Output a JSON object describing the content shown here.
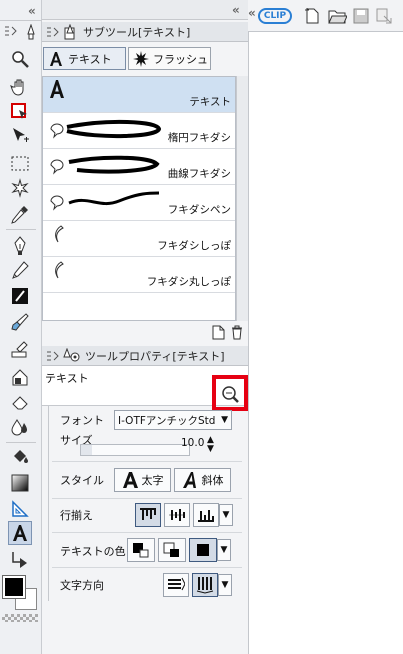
{
  "toolbar": {
    "logo": "CLIP"
  },
  "subtool_panel": {
    "tab_title": "サブツール[テキスト]",
    "tabs": [
      {
        "label": "テキスト",
        "active": true
      },
      {
        "label": "フラッシュ",
        "active": false
      }
    ],
    "items": [
      {
        "label": "テキスト",
        "selected": true
      },
      {
        "label": "楕円フキダシ",
        "selected": false
      },
      {
        "label": "曲線フキダシ",
        "selected": false
      },
      {
        "label": "フキダシペン",
        "selected": false
      },
      {
        "label": "フキダシしっぽ",
        "selected": false
      },
      {
        "label": "フキダシ丸しっぽ",
        "selected": false
      }
    ]
  },
  "property_panel": {
    "tab_title": "ツールプロパティ[テキスト]",
    "tool_name": "テキスト",
    "font_label": "フォント",
    "font_value": "I-OTFアンチックStd",
    "size_label": "サイズ",
    "size_value": "10.0",
    "size_fraction": 0.1,
    "style_label": "スタイル",
    "bold_label": "太字",
    "italic_label": "斜体",
    "align_label": "行揃え",
    "color_label": "テキストの色",
    "direction_label": "文字方向"
  },
  "colors": {
    "accent_red": "#e60012",
    "selection_blue": "#cfe0f2",
    "logo_blue": "#2a7fd4"
  }
}
